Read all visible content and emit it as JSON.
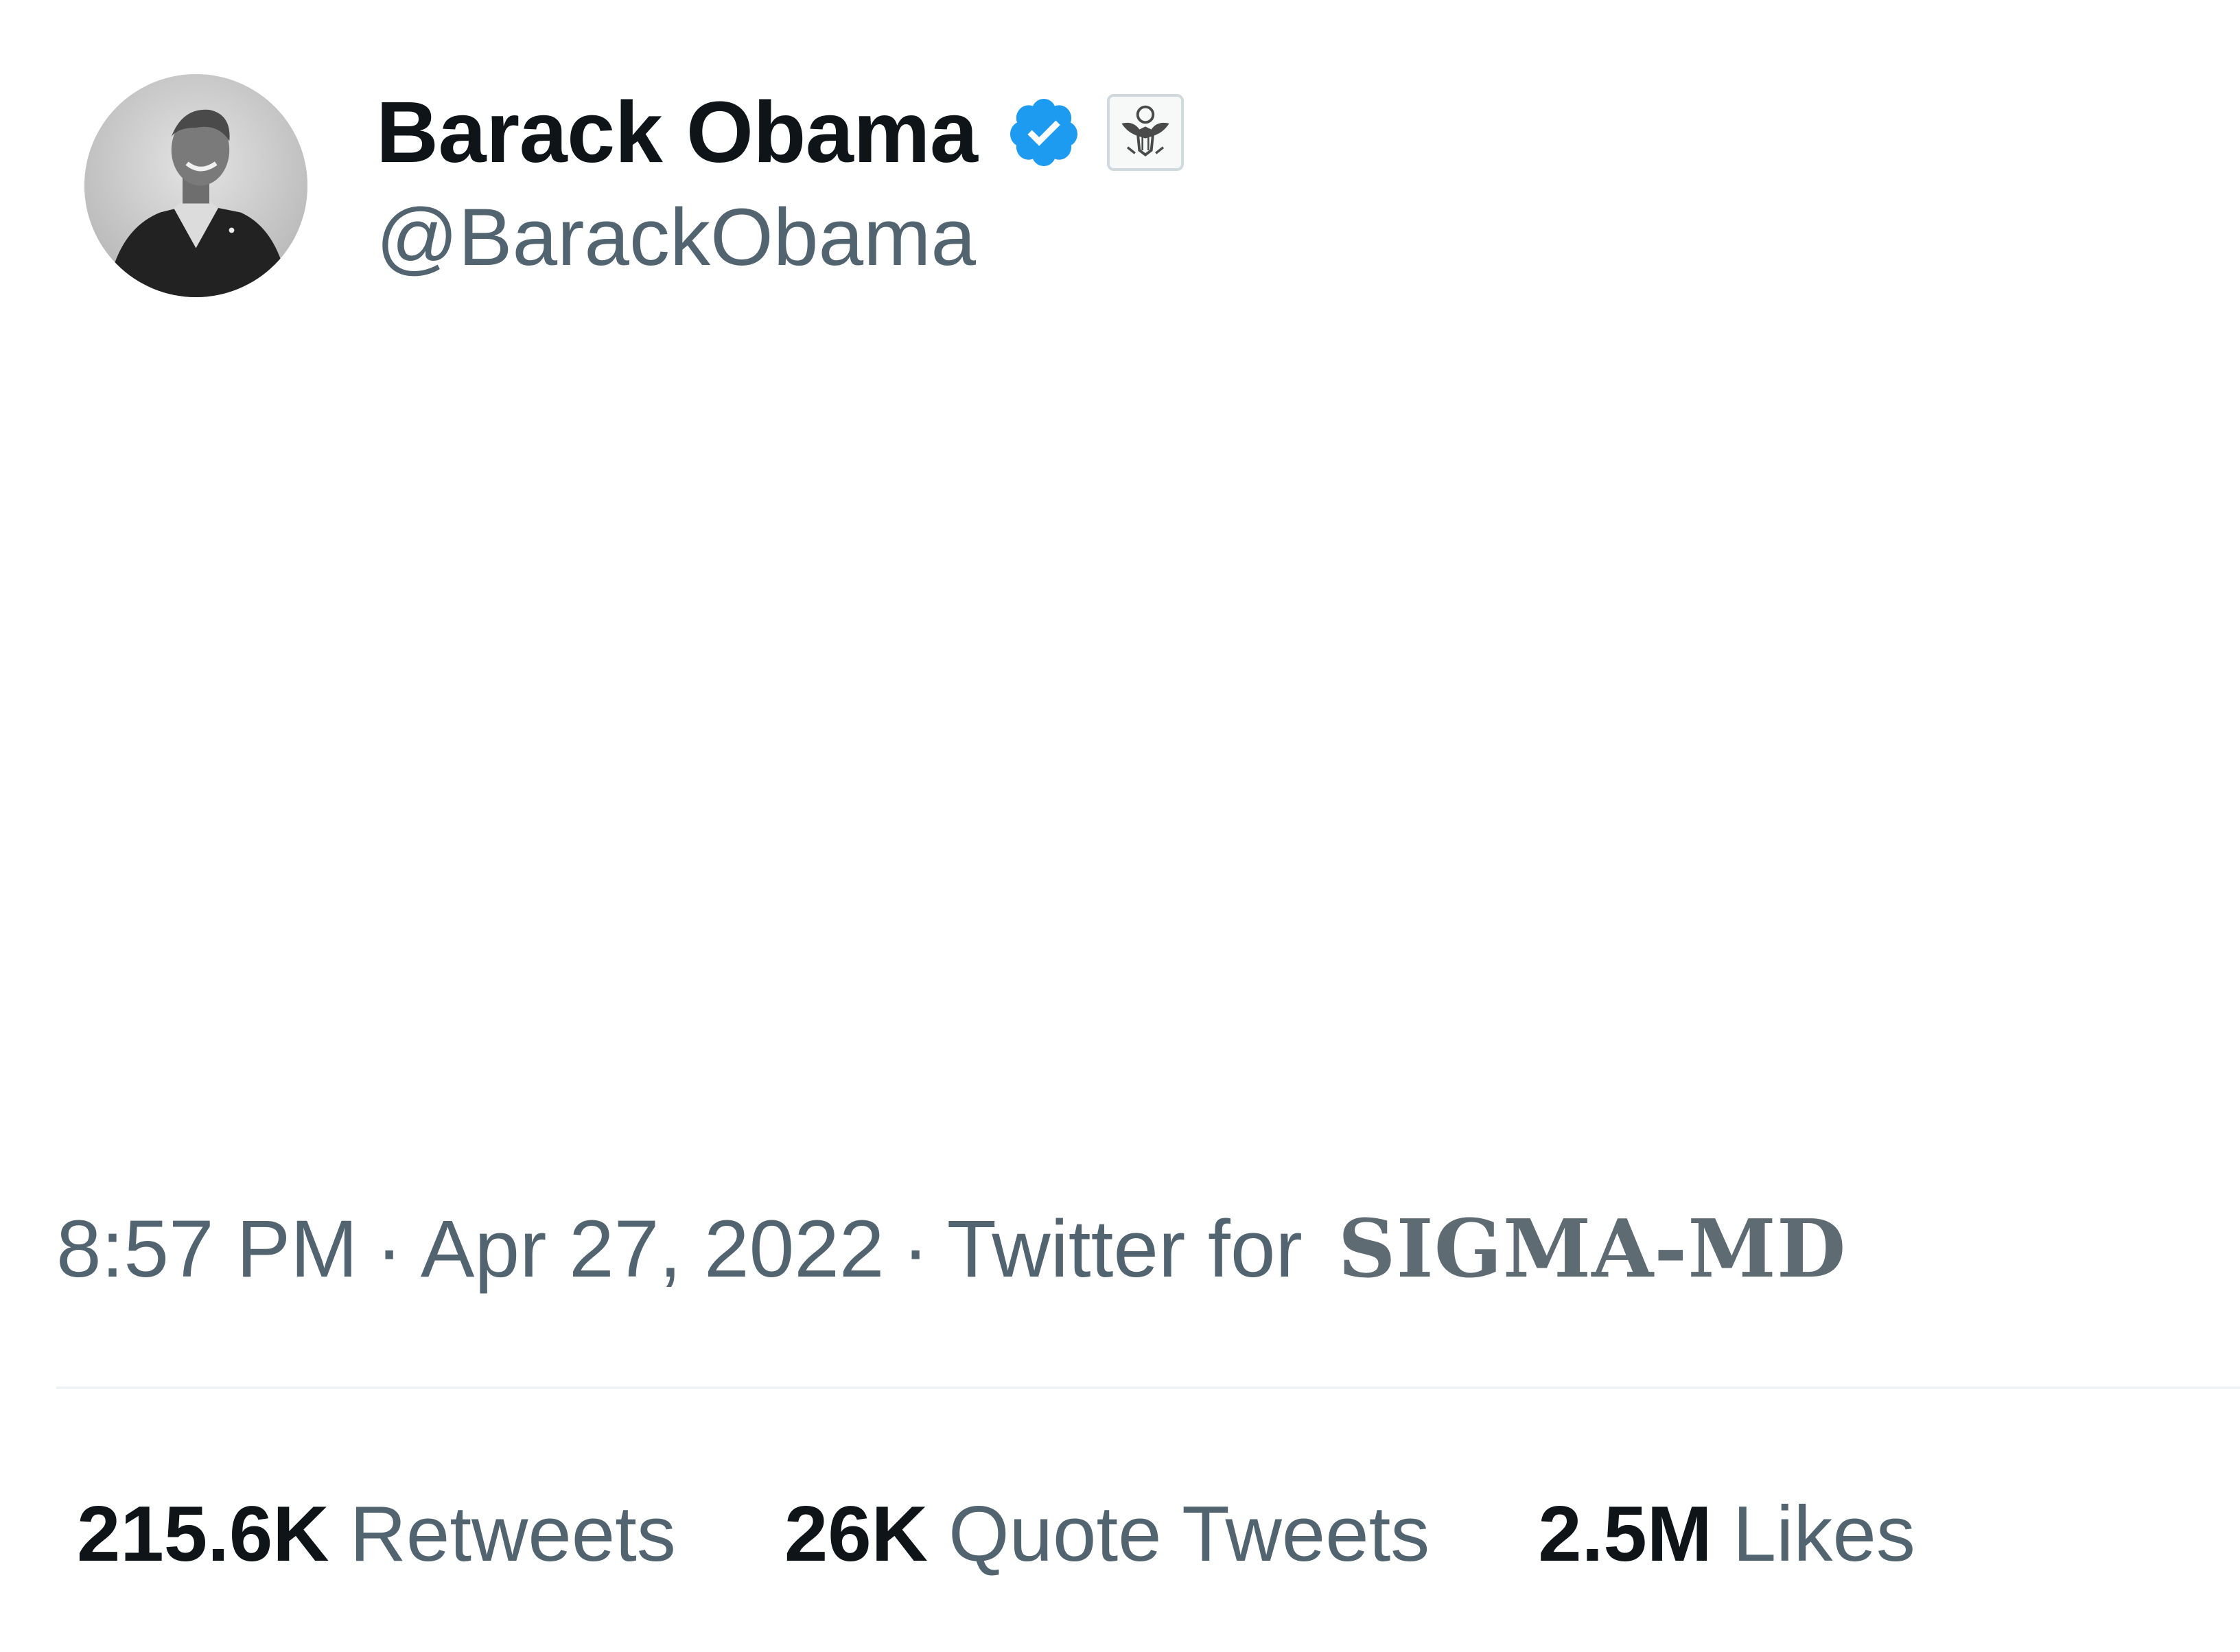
{
  "author": {
    "display_name": "Barack Obama",
    "handle": "@BarackObama",
    "avatar_icon": "profile-photo",
    "verified_icon": "verified-checkmark-icon",
    "affiliate_icon": "us-government-seal-icon",
    "verified_color": "#1d9bf0"
  },
  "meta": {
    "time": "8:57 PM",
    "separator": "·",
    "date": "Apr 27, 2022",
    "source_prefix": "Twitter for",
    "source_name": "SIGMA-MD"
  },
  "stats": [
    {
      "count": "215.6K",
      "label": "Retweets"
    },
    {
      "count": "26K",
      "label": "Quote Tweets"
    },
    {
      "count": "2.5M",
      "label": "Likes"
    }
  ],
  "colors": {
    "text_primary": "#0f1419",
    "text_secondary": "#536471",
    "divider": "#eff3f4"
  }
}
